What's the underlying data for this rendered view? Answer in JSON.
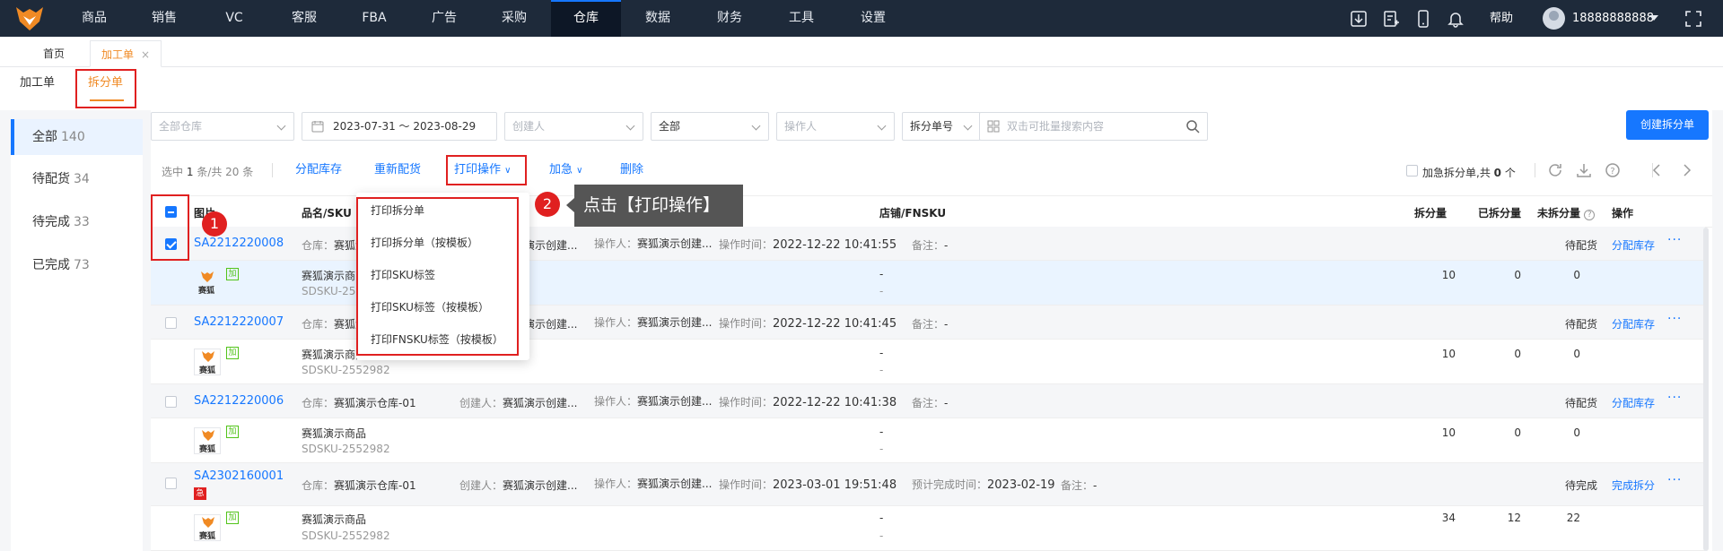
{
  "topnav": {
    "items": [
      "商品",
      "销售",
      "VC",
      "客服",
      "FBA",
      "广告",
      "采购",
      "仓库",
      "数据",
      "财务",
      "工具",
      "设置"
    ],
    "active_index": 7,
    "help": "帮助",
    "username": "18888888888"
  },
  "page_tabs": [
    {
      "label": "首页"
    },
    {
      "label": "加工单",
      "close": "×"
    }
  ],
  "sub_tabs": [
    {
      "label": "加工单"
    },
    {
      "label": "拆分单"
    }
  ],
  "sidebar": [
    {
      "label": "全部",
      "count": "140"
    },
    {
      "label": "待配货",
      "count": "34"
    },
    {
      "label": "待完成",
      "count": "33"
    },
    {
      "label": "已完成",
      "count": "73"
    }
  ],
  "filters": {
    "warehouse": "全部仓库",
    "date_range": "2023-07-31 ～ 2023-08-29",
    "creator": "创建人",
    "status": "全部",
    "operator": "操作人",
    "search_type": "拆分单号",
    "search_placeholder": "双击可批量搜索内容"
  },
  "create_button": "创建拆分单",
  "toolbar": {
    "sel_prefix": "选中",
    "sel_count": "1",
    "sel_suffix": "条/共 20 条",
    "allocate": "分配库存",
    "reallocate": "重新配货",
    "print": "打印操作",
    "urgent": "加急",
    "delete": "删除",
    "urgent_label": "加急拆分单,共",
    "urgent_count": "0",
    "urgent_unit": "个"
  },
  "table_header": {
    "image": "图片",
    "name_sku": "品名/SKU",
    "shop_fnsku": "店铺/FNSKU",
    "split_qty": "拆分量",
    "done_qty": "已拆分量",
    "undone_qty": "未拆分量",
    "ops": "操作"
  },
  "dropdown": [
    "打印拆分单",
    "打印拆分单（按模板）",
    "打印SKU标签",
    "打印SKU标签（按模板）",
    "打印FNSKU标签（按模板）"
  ],
  "annotations": {
    "badge1": "1",
    "badge2": "2",
    "tooltip": "点击【打印操作】"
  },
  "labels": {
    "warehouse": "仓库：",
    "creator": "创建人：",
    "operator": "操作人：",
    "op_time": "操作时间：",
    "remark": "备注：",
    "eta": "预计完成时间：",
    "jia": "加",
    "ji": "急",
    "brand": "赛狐"
  },
  "orders": [
    {
      "code": "SA2212220008",
      "warehouse": "赛狐演示仓库-01",
      "creator": "赛狐演示创建...",
      "operator": "赛狐演示创建...",
      "time": "2022-12-22 10:41:55",
      "remark": "-",
      "status": "待配货",
      "action": "分配库存",
      "product": "赛狐演示商品",
      "sku": "SDSKU-2552982",
      "fnsku1": "-",
      "fnsku2": "-",
      "split": "10",
      "done": "0",
      "undone": "0"
    },
    {
      "code": "SA2212220007",
      "warehouse": "赛狐演示仓库-01",
      "creator": "赛狐演示创建...",
      "operator": "赛狐演示创建...",
      "time": "2022-12-22 10:41:45",
      "remark": "-",
      "status": "待配货",
      "action": "分配库存",
      "product": "赛狐演示商品",
      "sku": "SDSKU-2552982",
      "fnsku1": "-",
      "fnsku2": "-",
      "split": "10",
      "done": "0",
      "undone": "0"
    },
    {
      "code": "SA2212220006",
      "warehouse": "赛狐演示仓库-01",
      "creator": "赛狐演示创建...",
      "operator": "赛狐演示创建...",
      "time": "2022-12-22 10:41:38",
      "remark": "-",
      "status": "待配货",
      "action": "分配库存",
      "product": "赛狐演示商品",
      "sku": "SDSKU-2552982",
      "fnsku1": "-",
      "fnsku2": "-",
      "split": "10",
      "done": "0",
      "undone": "0"
    },
    {
      "code": "SA2302160001",
      "warehouse": "赛狐演示仓库-01",
      "creator": "赛狐演示创建...",
      "operator": "赛狐演示创建...",
      "time": "2023-03-01 19:51:48",
      "eta": "2023-02-19",
      "remark": "-",
      "status": "待完成",
      "action": "完成拆分",
      "product": "赛狐演示商品",
      "sku": "SDSKU-2552982",
      "fnsku1": "-",
      "fnsku2": "-",
      "split": "34",
      "done": "12",
      "undone": "22"
    }
  ]
}
